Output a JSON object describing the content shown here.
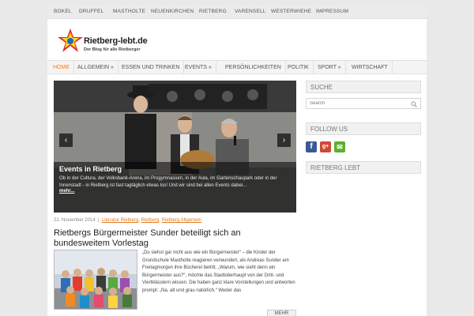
{
  "top_nav": [
    "BOKEL",
    "DRUFFEL",
    "MASTHOLTE",
    "NEUENKIRCHEN",
    "RIETBERG",
    "VARENSELL",
    "WESTERWIEHE",
    "IMPRESSUM"
  ],
  "logo": {
    "title": "Rietberg-lebt.de",
    "tagline": "Der Blog für alle Rietberger"
  },
  "main_nav": [
    {
      "label": "HOME"
    },
    {
      "label": "ALLGEMEIN »"
    },
    {
      "label": "ESSEN UND TRINKEN"
    },
    {
      "label": "EVENTS »"
    },
    {
      "label": "PERSÖNLICHKEITEN"
    },
    {
      "label": "POLITIK"
    },
    {
      "label": "SPORT »"
    },
    {
      "label": "WIRTSCHAFT"
    }
  ],
  "slider": {
    "title": "Events in Rietberg",
    "text": "Ob in der Cultura, der Volksbank-Arena, im Progymnasium, in der Aula, im Gartenschaupark oder in der Innenstadt - in Rietberg ist fast tagtäglich etwas los! Und wir sind bei allen Events dabei...",
    "more": "mehr...",
    "prev_glyph": "‹",
    "next_glyph": "›"
  },
  "post": {
    "date": "22. November 2014",
    "categories": [
      "Literatur Rietberg",
      "Rietberg",
      "Rietberg Allgemein"
    ],
    "title": "Rietbergs Bürgermeister Sunder beteiligt sich an bundesweitem Vorlestag",
    "excerpt": "„Du siehst gar nicht aus wie ein Bürgermeister“ – die Kinder der Grundschule Mastholte reagieren verwundert, als Andreas Sunder am Freitagmorgen ihre Bücherei betritt. „Warum, wie sieht denn ein Bürgermeister aus?“, möchte das Stadtoberhaupt von der Dritt- und Viertklässlern wissen. Die haben ganz klare Vorstellungen und antworten prompt: „Na, alt und grau natürlich.“ Weder das",
    "more_label": "MEHR"
  },
  "sidebar": {
    "search_title": "SUCHE",
    "search_placeholder": "Search",
    "follow_title": "FOLLOW US",
    "social": [
      {
        "name": "facebook",
        "glyph": "f",
        "color": "#3b5998"
      },
      {
        "name": "google-plus",
        "glyph": "g+",
        "color": "#d14836"
      },
      {
        "name": "email",
        "glyph": "✉",
        "color": "#5cb030"
      }
    ],
    "rietberg_title": "RIETBERG LEBT"
  },
  "colors": {
    "accent": "#f47c20",
    "link": "#e07a1e"
  }
}
